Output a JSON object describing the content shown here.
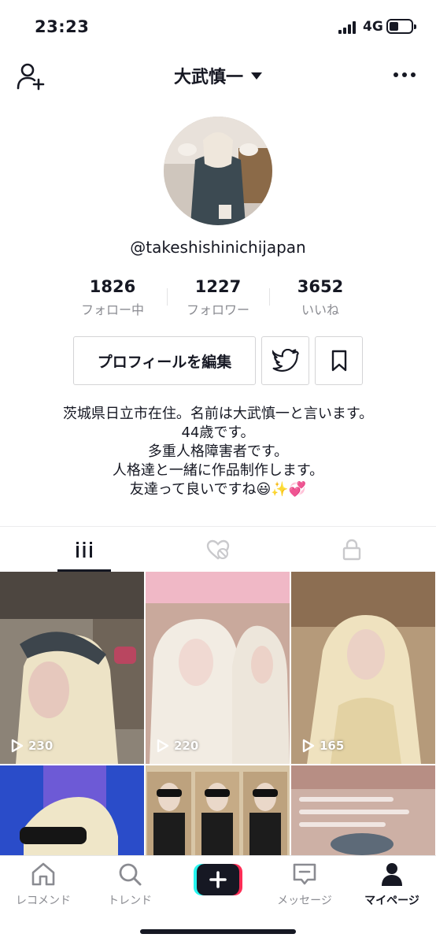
{
  "status_bar": {
    "time": "23:23",
    "network": "4G"
  },
  "header": {
    "title": "大武慎一"
  },
  "profile": {
    "handle": "@takeshishinichijapan",
    "stats": [
      {
        "value": "1826",
        "label": "フォロー中"
      },
      {
        "value": "1227",
        "label": "フォロワー"
      },
      {
        "value": "3652",
        "label": "いいね"
      }
    ],
    "edit_button_label": "プロフィールを編集",
    "bio": [
      "茨城県日立市在住。名前は大武慎一と言います。",
      "44歳です。",
      "多重人格障害者です。",
      "人格達と一緒に作品制作します。",
      "友達って良いですね😃✨💞"
    ]
  },
  "tabs": [
    {
      "name": "videos",
      "icon": "grid-icon",
      "active": true
    },
    {
      "name": "liked",
      "icon": "liked-hidden-icon",
      "active": false
    },
    {
      "name": "private",
      "icon": "lock-icon",
      "active": false
    }
  ],
  "videos": [
    {
      "views": "230"
    },
    {
      "views": "220"
    },
    {
      "views": "165"
    },
    {
      "views": ""
    },
    {
      "views": ""
    },
    {
      "views": ""
    }
  ],
  "bottom_nav": [
    {
      "label": "レコメンド",
      "icon": "home-icon",
      "active": false
    },
    {
      "label": "トレンド",
      "icon": "search-icon",
      "active": false
    },
    {
      "label": "",
      "icon": "plus-icon",
      "active": false
    },
    {
      "label": "メッセージ",
      "icon": "inbox-icon",
      "active": false
    },
    {
      "label": "マイページ",
      "icon": "profile-icon",
      "active": true
    }
  ],
  "colors": {
    "text": "#161823",
    "muted": "#8a8b91",
    "cyan": "#25f4ee",
    "red": "#fe2c55"
  }
}
